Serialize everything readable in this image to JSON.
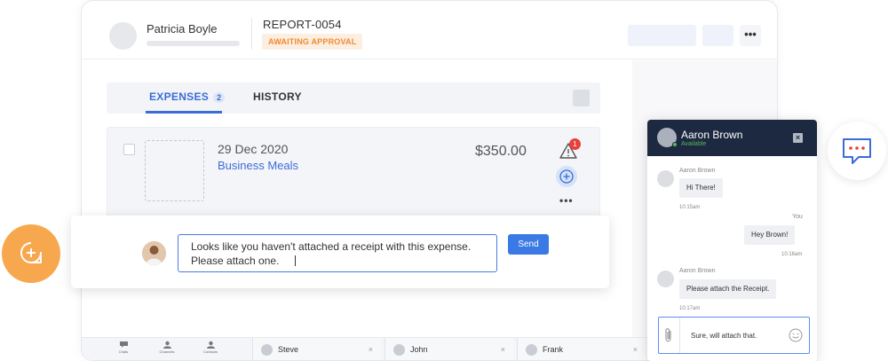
{
  "header": {
    "user_name": "Patricia Boyle",
    "report_id": "REPORT-0054",
    "status": "AWAITING APPROVAL",
    "more_label": "•••"
  },
  "tabs": [
    {
      "label": "EXPENSES",
      "count": "2",
      "active": true
    },
    {
      "label": "HISTORY",
      "active": false
    }
  ],
  "expense": {
    "date": "29 Dec 2020",
    "category": "Business Meals",
    "amount": "$350.00",
    "warning_count": "1",
    "more_label": "•••"
  },
  "comment": {
    "text_line1": "Looks like you haven't attached a receipt with this expense.",
    "text_line2": "Please attach one.",
    "send_label": "Send"
  },
  "footer": {
    "nav": [
      {
        "label": "Chats",
        "icon": "chats-icon"
      },
      {
        "label": "Channels",
        "icon": "channels-icon"
      },
      {
        "label": "Contacts",
        "icon": "contacts-icon"
      }
    ],
    "chat_tabs": [
      {
        "name": "Steve",
        "close": "×"
      },
      {
        "name": "John",
        "close": "×"
      },
      {
        "name": "Frank",
        "close": "×"
      }
    ]
  },
  "chat": {
    "contact_name": "Aaron Brown",
    "contact_status": "Available",
    "close_label": "×",
    "messages": [
      {
        "author": "Aaron Brown",
        "text": "Hi There!",
        "time": "10:15am",
        "side": "left"
      },
      {
        "author": "You",
        "text": "Hey Brown!",
        "time": "10:16am",
        "side": "right"
      },
      {
        "author": "Aaron Brown",
        "text": "Please attach the Receipt.",
        "time": "10:17am",
        "side": "left"
      }
    ],
    "input_value": "Sure, will attach that."
  },
  "colors": {
    "accent_blue": "#3b6cd9",
    "status_orange": "#ef8a2f",
    "fab_orange": "#f7a84f",
    "chat_header": "#1d2940",
    "online_green": "#5ab55a",
    "alert_red": "#e8403a"
  }
}
